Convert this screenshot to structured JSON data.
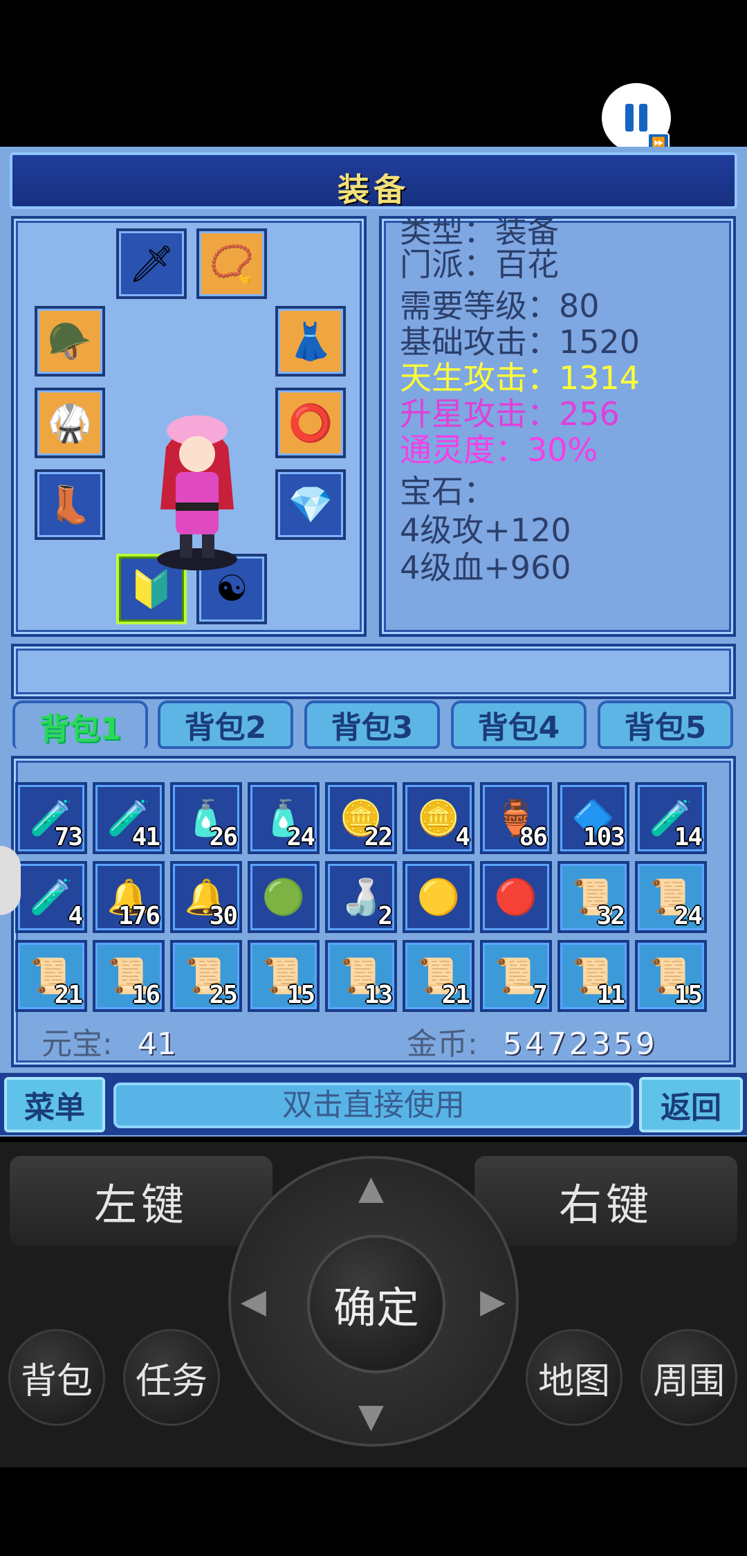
{
  "title": "装备",
  "equipment": {
    "slots": [
      {
        "icon": "weapon-icon",
        "glyph": "🗡"
      },
      {
        "icon": "necklace-icon",
        "glyph": "📿"
      },
      {
        "icon": "helmet-icon",
        "glyph": "🪖"
      },
      {
        "icon": "robe-icon",
        "glyph": "👗"
      },
      {
        "icon": "armor-icon",
        "glyph": "🥋"
      },
      {
        "icon": "ring-icon",
        "glyph": "⭕"
      },
      {
        "icon": "boots-icon",
        "glyph": "👢"
      },
      {
        "icon": "gem-icon",
        "glyph": "💎"
      },
      {
        "icon": "charm-icon",
        "glyph": "🔰"
      },
      {
        "icon": "bead-icon",
        "glyph": "☯"
      }
    ]
  },
  "info": {
    "lines": [
      {
        "text": "类型：装备"
      },
      {
        "text": "门派：百花"
      },
      {
        "text": "需要等级：80"
      },
      {
        "text": "基础攻击：1520"
      },
      {
        "text": "天生攻击：1314"
      },
      {
        "text": "升星攻击：256"
      },
      {
        "text": "通灵度：30%"
      },
      {
        "text": "宝石："
      },
      {
        "text": "4级攻+120"
      },
      {
        "text": "4级血+960"
      }
    ]
  },
  "tabs": [
    "背包1",
    "背包2",
    "背包3",
    "背包4",
    "背包5"
  ],
  "bag": {
    "items": [
      {
        "icon": "potion-flask-icon",
        "glyph": "🧪",
        "count": "73"
      },
      {
        "icon": "potion-flask-icon",
        "glyph": "🧪",
        "count": "41"
      },
      {
        "icon": "red-potion-icon",
        "glyph": "🧴",
        "count": "26"
      },
      {
        "icon": "red-potion-icon",
        "glyph": "🧴",
        "count": "24"
      },
      {
        "icon": "round-token-icon",
        "glyph": "🪙",
        "count": "22"
      },
      {
        "icon": "round-token-icon",
        "glyph": "🪙",
        "count": "4"
      },
      {
        "icon": "red-gourd-icon",
        "glyph": "🏺",
        "count": "86"
      },
      {
        "icon": "blue-orb-icon",
        "glyph": "🔷",
        "count": "103"
      },
      {
        "icon": "blue-potion-icon",
        "glyph": "🧪",
        "count": "14"
      },
      {
        "icon": "blue-potion-icon",
        "glyph": "🧪",
        "count": "4"
      },
      {
        "icon": "blue-bell-icon",
        "glyph": "🔔",
        "count": "176"
      },
      {
        "icon": "blue-bell-icon",
        "glyph": "🔔",
        "count": "30"
      },
      {
        "icon": "green-orb-icon",
        "glyph": "🟢",
        "count": ""
      },
      {
        "icon": "gourd-icon",
        "glyph": "🍶",
        "count": "2"
      },
      {
        "icon": "gold-orb-icon",
        "glyph": "🟡",
        "count": ""
      },
      {
        "icon": "red-pearl-icon",
        "glyph": "🔴",
        "count": ""
      },
      {
        "icon": "scroll-icon",
        "glyph": "📜",
        "count": "32"
      },
      {
        "icon": "scroll-icon",
        "glyph": "📜",
        "count": "24"
      },
      {
        "icon": "scroll-icon",
        "glyph": "📜",
        "count": "21"
      },
      {
        "icon": "scroll-icon",
        "glyph": "📜",
        "count": "16"
      },
      {
        "icon": "scroll-icon",
        "glyph": "📜",
        "count": "25"
      },
      {
        "icon": "scroll-icon",
        "glyph": "📜",
        "count": "15"
      },
      {
        "icon": "scroll-icon",
        "glyph": "📜",
        "count": "13"
      },
      {
        "icon": "scroll-icon",
        "glyph": "📜",
        "count": "21"
      },
      {
        "icon": "scroll-icon",
        "glyph": "📜",
        "count": "7"
      },
      {
        "icon": "scroll-icon",
        "glyph": "📜",
        "count": "11"
      },
      {
        "icon": "scroll-icon",
        "glyph": "📜",
        "count": "15"
      }
    ]
  },
  "currency": {
    "yuanbao_label": "元宝:",
    "yuanbao_value": "41",
    "gold_label": "金币:",
    "gold_value": "5472359"
  },
  "commands": {
    "menu": "菜单",
    "hint": "双击直接使用",
    "back": "返回"
  },
  "pad": {
    "left_key": "左键",
    "right_key": "右键",
    "confirm": "确定",
    "bag": "背包",
    "quest": "任务",
    "map": "地图",
    "around": "周围"
  }
}
